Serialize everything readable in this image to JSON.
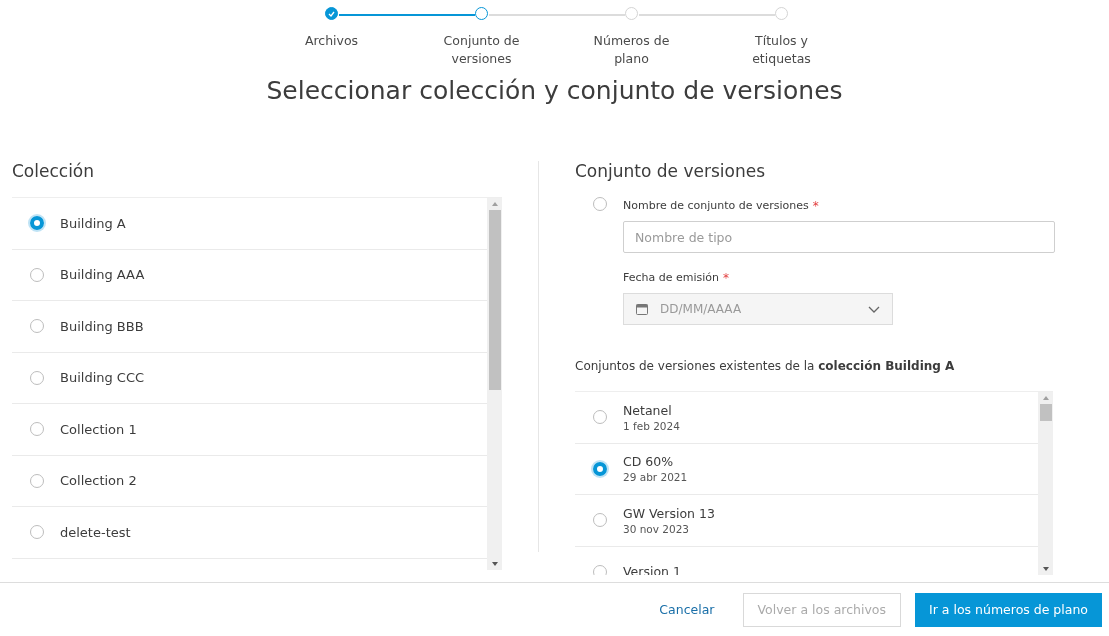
{
  "stepper": [
    {
      "label": "Archivos",
      "completed": true,
      "selected": false
    },
    {
      "label": "Conjunto de versiones",
      "completed": false,
      "selected": true
    },
    {
      "label": "Números de plano",
      "completed": false,
      "selected": false
    },
    {
      "label": "Títulos y etiquetas",
      "completed": false,
      "selected": false
    }
  ],
  "title": "Seleccionar colección y conjunto de versiones",
  "collection": {
    "heading": "Colección",
    "items": [
      {
        "name": "Building A",
        "selected": true
      },
      {
        "name": "Building AAA",
        "selected": false
      },
      {
        "name": "Building BBB",
        "selected": false
      },
      {
        "name": "Building CCC",
        "selected": false
      },
      {
        "name": "Collection 1",
        "selected": false
      },
      {
        "name": "Collection 2",
        "selected": false
      },
      {
        "name": "delete-test",
        "selected": false
      }
    ]
  },
  "version_set": {
    "heading": "Conjunto de versiones",
    "new_selected": false,
    "name_field": {
      "label": "Nombre de conjunto de versiones",
      "required_mark": "*",
      "placeholder": "Nombre de tipo"
    },
    "date_field": {
      "label": "Fecha de emisión",
      "required_mark": "*",
      "placeholder": "DD/MM/AAAA"
    },
    "existing_caption": "Conjuntos de versiones existentes de la **colección Building A**",
    "existing": [
      {
        "name": "Netanel",
        "date": "1 feb 2024",
        "selected": false
      },
      {
        "name": "CD 60%",
        "date": "29 abr 2021",
        "selected": true
      },
      {
        "name": "GW Version 13",
        "date": "30 nov 2023",
        "selected": false
      },
      {
        "name": "Version 1",
        "selected": false
      }
    ]
  },
  "footer": {
    "buttons": [
      {
        "label": "Cancelar",
        "kind": "link",
        "disabled": false
      },
      {
        "label": "Volver a los archivos",
        "kind": "secondary",
        "disabled": true
      },
      {
        "label": "Ir a los números de plano",
        "kind": "primary",
        "disabled": false
      }
    ]
  }
}
